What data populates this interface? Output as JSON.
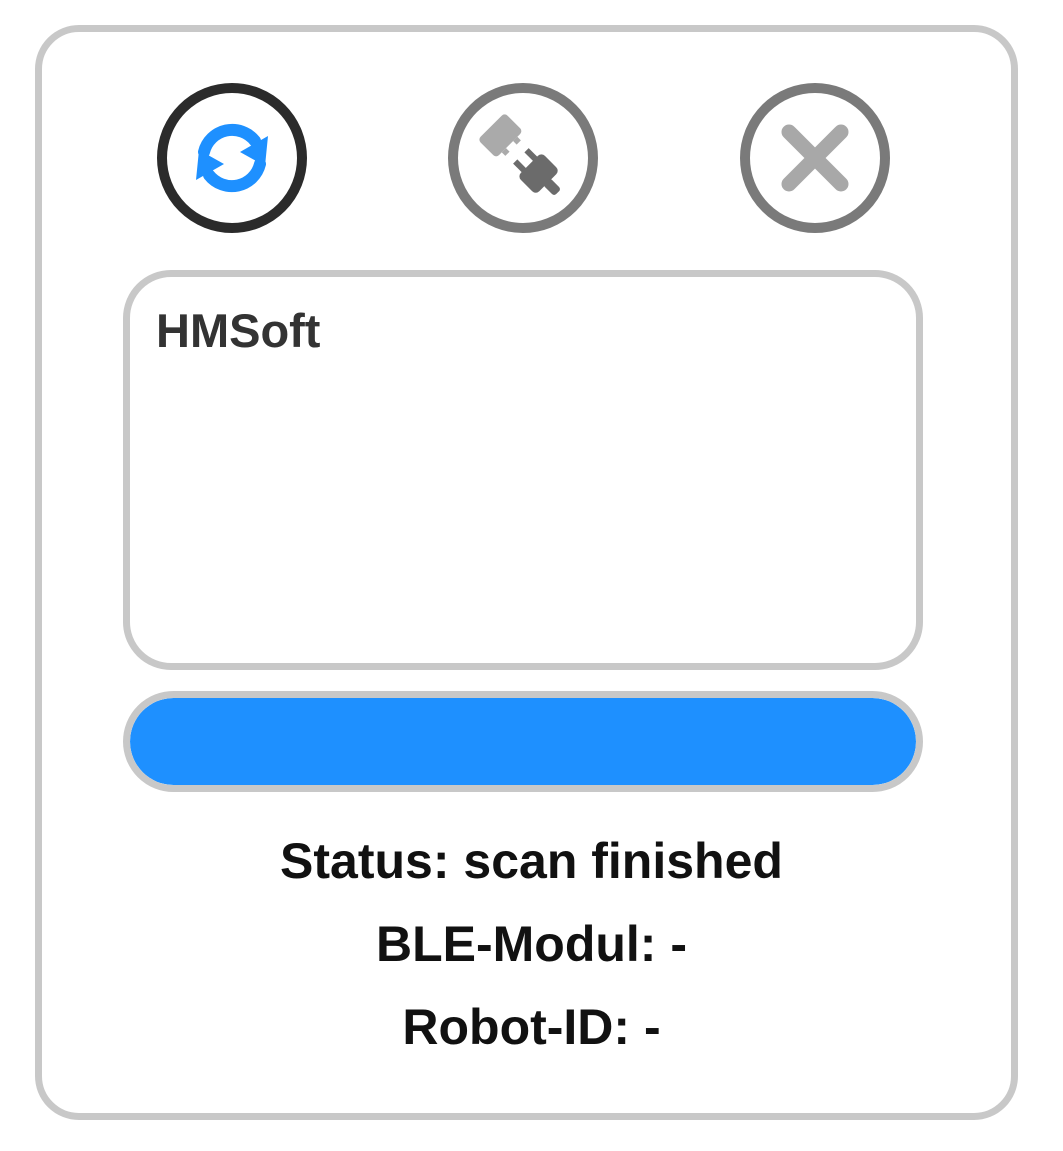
{
  "colors": {
    "accent": "#1e90ff",
    "active_icon_border": "#2b2b2b",
    "inactive_icon": "#7a7a7a",
    "frame_border": "#c8c8c8"
  },
  "toolbar": {
    "refresh_icon": "refresh-icon",
    "connect_icon": "plug-icon",
    "close_icon": "close-icon"
  },
  "device_list": {
    "items": [
      "HMSoft"
    ]
  },
  "progress": {
    "fraction": 1.0
  },
  "info": {
    "status": "Status: scan finished",
    "ble_module": "BLE-Modul: -",
    "robot_id": "Robot-ID: -"
  }
}
